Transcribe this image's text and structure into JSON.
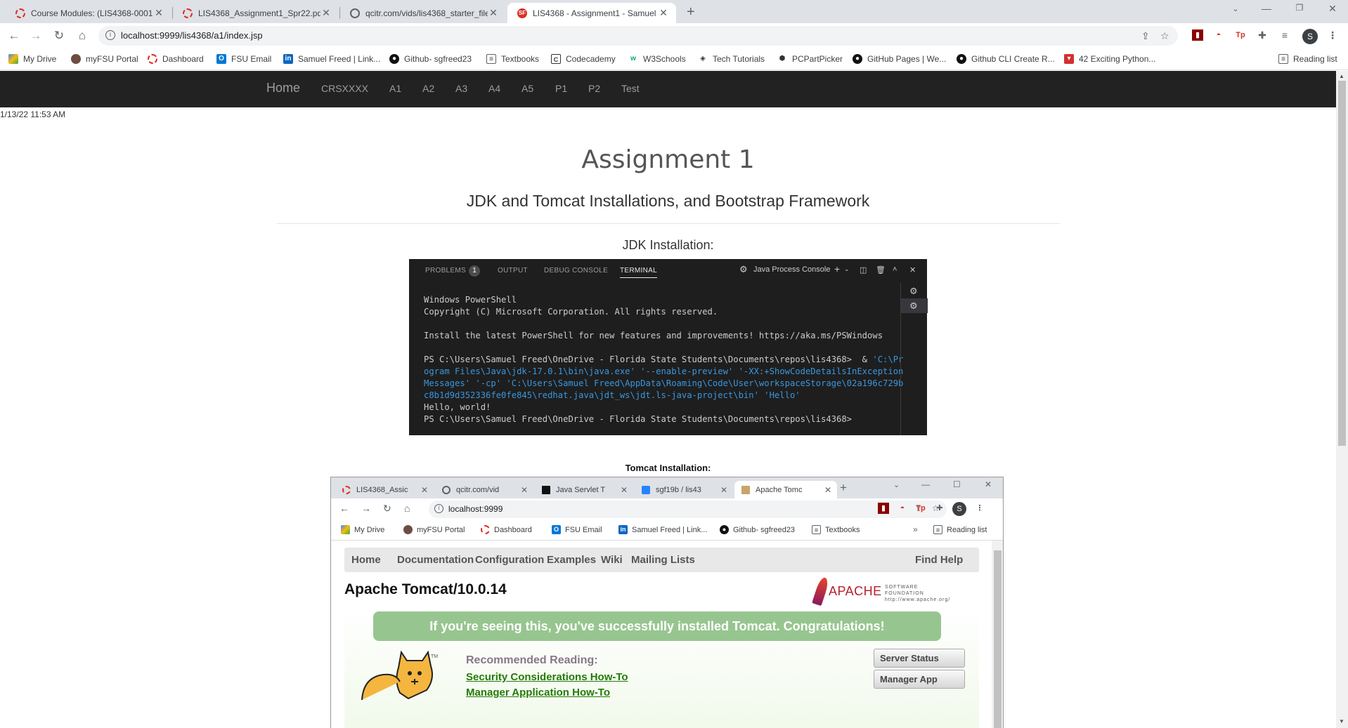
{
  "browser": {
    "tabs": [
      {
        "title": "Course Modules: (LIS4368-0001.s",
        "icon": "red-ring"
      },
      {
        "title": "LIS4368_Assignment1_Spr22.pdf",
        "icon": "red-ring"
      },
      {
        "title": "qcitr.com/vids/lis4368_starter_file",
        "icon": "globe"
      },
      {
        "title": "LIS4368 - Assignment1 - Samuel",
        "icon": "sf"
      }
    ],
    "url": "localhost:9999/lis4368/a1/index.jsp",
    "bookmarks": [
      "My Drive",
      "myFSU Portal",
      "Dashboard",
      "FSU Email",
      "Samuel Freed | Link...",
      "Github- sgfreed23",
      "Textbooks",
      "Codecademy",
      "W3Schools",
      "Tech Tutorials",
      "PCPartPicker",
      "GitHub Pages | We...",
      "Github CLI Create R...",
      "42 Exciting Python..."
    ],
    "reading_list": "Reading list",
    "avatar_letter": "S",
    "ext_tp": "Tp"
  },
  "site": {
    "nav": {
      "brand": "Home",
      "items": [
        "CRSXXXX",
        "A1",
        "A2",
        "A3",
        "A4",
        "A5",
        "P1",
        "P2",
        "Test"
      ]
    },
    "timestamp": "1/13/22 11:53 AM",
    "title": "Assignment 1",
    "subtitle": "JDK and Tomcat Installations, and Bootstrap Framework",
    "jdk_heading": "JDK Installation:",
    "tomcat_heading": "Tomcat Installation:"
  },
  "terminal": {
    "tabs": [
      "PROBLEMS",
      "OUTPUT",
      "DEBUG CONSOLE",
      "TERMINAL"
    ],
    "problems_count": "1",
    "console_label": "Java Process Console",
    "lines": {
      "l1": "Windows PowerShell",
      "l2": "Copyright (C) Microsoft Corporation. All rights reserved.",
      "l3": "Install the latest PowerShell for new features and improvements! https://aka.ms/PSWindows",
      "l4a": "PS C:\\Users\\Samuel Freed\\OneDrive - Florida State Students\\Documents\\repos\\lis4368>  & ",
      "l4b": "'C:\\Pr",
      "l5": "ogram Files\\Java\\jdk-17.0.1\\bin\\java.exe' '--enable-preview' '-XX:+ShowCodeDetailsInException",
      "l6": "Messages' '-cp' 'C:\\Users\\Samuel Freed\\AppData\\Roaming\\Code\\User\\workspaceStorage\\02a196c729b",
      "l7": "c8b1d9d352336fe0fe845\\redhat.java\\jdt_ws\\jdt.ls-java-project\\bin' 'Hello'",
      "l8": "Hello, world!",
      "l9": "PS C:\\Users\\Samuel Freed\\OneDrive - Florida State Students\\Documents\\repos\\lis4368>"
    }
  },
  "tomcat_shot": {
    "tabs": [
      "LIS4368_Assic",
      "qcitr.com/vid",
      "Java Servlet T",
      "sgf19b / lis43",
      "Apache Tomc"
    ],
    "url": "localhost:9999",
    "bookmarks": [
      "My Drive",
      "myFSU Portal",
      "Dashboard",
      "FSU Email",
      "Samuel Freed | Link...",
      "Github- sgfreed23",
      "Textbooks"
    ],
    "reading_list": "Reading list",
    "nav": [
      "Home",
      "Documentation",
      "Configuration",
      "Examples",
      "Wiki",
      "Mailing Lists"
    ],
    "find_help": "Find Help",
    "title": "Apache Tomcat/10.0.14",
    "apache_word": "APACHE",
    "apache_sub1": "SOFTWARE FOUNDATION",
    "apache_sub2": "http://www.apache.org/",
    "banner": "If you're seeing this, you've successfully installed Tomcat. Congratulations!",
    "recommended": "Recommended Reading:",
    "links": [
      "Security Considerations How-To",
      "Manager Application How-To"
    ],
    "buttons": [
      "Server Status",
      "Manager App"
    ]
  }
}
